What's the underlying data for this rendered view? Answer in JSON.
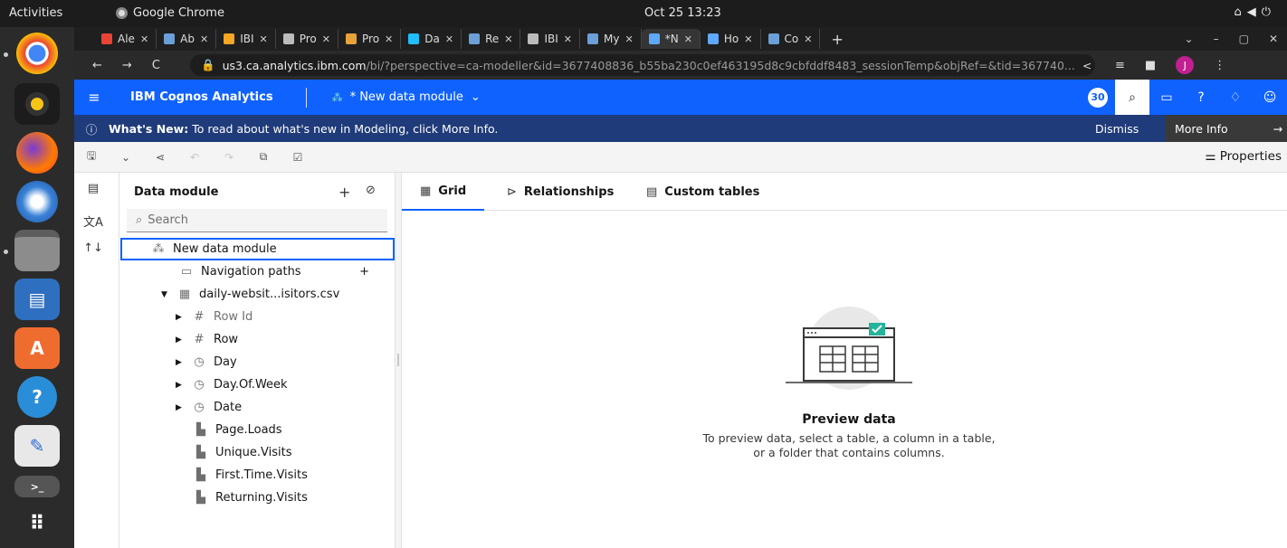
{
  "desktop": {
    "activities": "Activities",
    "app_name": "Google Chrome",
    "clock": "Oct 25  13:23"
  },
  "browser": {
    "tabs": [
      {
        "label": "Ale",
        "icon": "gmail-icon",
        "color": "#ea4335"
      },
      {
        "label": "Ab",
        "icon": "site-icon",
        "color": "#6a9fd8"
      },
      {
        "label": "IBI",
        "icon": "ibm-icon",
        "color": "#f5a623"
      },
      {
        "label": "Pro",
        "icon": "globe-icon",
        "color": "#bbbbbb"
      },
      {
        "label": "Pro",
        "icon": "flower-icon",
        "color": "#e8a23a"
      },
      {
        "label": "Da",
        "icon": "kaggle-icon",
        "color": "#20beff"
      },
      {
        "label": "Re",
        "icon": "site-icon",
        "color": "#6a9fd8"
      },
      {
        "label": "IBI",
        "icon": "ibm-icon",
        "color": "#bbbbbb"
      },
      {
        "label": "My",
        "icon": "site-icon",
        "color": "#6a9fd8"
      },
      {
        "label": "*N",
        "icon": "cognos-icon",
        "color": "#5fa8ff",
        "active": true
      },
      {
        "label": "Ho",
        "icon": "cognos-icon",
        "color": "#5fa8ff"
      },
      {
        "label": "Co",
        "icon": "site-icon",
        "color": "#6a9fd8"
      }
    ],
    "url_host": "us3.ca.analytics.ibm.com",
    "url_path": "/bi/?perspective=ca-modeller&id=3677408836_b55ba230c0ef463195d8c9cbfddf8483_sessionTemp&objRef=&tid=367740...",
    "profile_initial": "J"
  },
  "header": {
    "brand": "IBM Cognos Analytics",
    "module_title": "* New data module",
    "notifications_count": "30"
  },
  "banner": {
    "title": "What's New:",
    "text": "To read about what's new in Modeling, click More Info.",
    "dismiss": "Dismiss",
    "more_info": "More Info"
  },
  "toolbar": {
    "properties": "Properties"
  },
  "tree": {
    "title": "Data module",
    "search_placeholder": "Search",
    "root": "New data module",
    "nav_paths": "Navigation paths",
    "table": "daily-websit...isitors.csv",
    "columns": [
      {
        "label": "Row Id",
        "icon": "#",
        "caret": true,
        "dim": true
      },
      {
        "label": "Row",
        "icon": "#",
        "caret": true,
        "dim": false
      },
      {
        "label": "Day",
        "icon": "clock",
        "caret": true,
        "dim": false
      },
      {
        "label": "Day.Of.Week",
        "icon": "clock",
        "caret": true,
        "dim": false
      },
      {
        "label": "Date",
        "icon": "clock",
        "caret": true,
        "dim": false
      },
      {
        "label": "Page.Loads",
        "icon": "measure",
        "caret": false,
        "dim": false
      },
      {
        "label": "Unique.Visits",
        "icon": "measure",
        "caret": false,
        "dim": false
      },
      {
        "label": "First.Time.Visits",
        "icon": "measure",
        "caret": false,
        "dim": false
      },
      {
        "label": "Returning.Visits",
        "icon": "measure",
        "caret": false,
        "dim": false
      }
    ]
  },
  "main": {
    "tabs": [
      "Grid",
      "Relationships",
      "Custom tables"
    ],
    "empty_title": "Preview data",
    "empty_desc": "To preview data, select a table, a column in a table, or a folder that contains columns."
  },
  "colors": {
    "accent": "#0f62fe",
    "banner": "#1f3b7a",
    "check": "#24b39b"
  }
}
